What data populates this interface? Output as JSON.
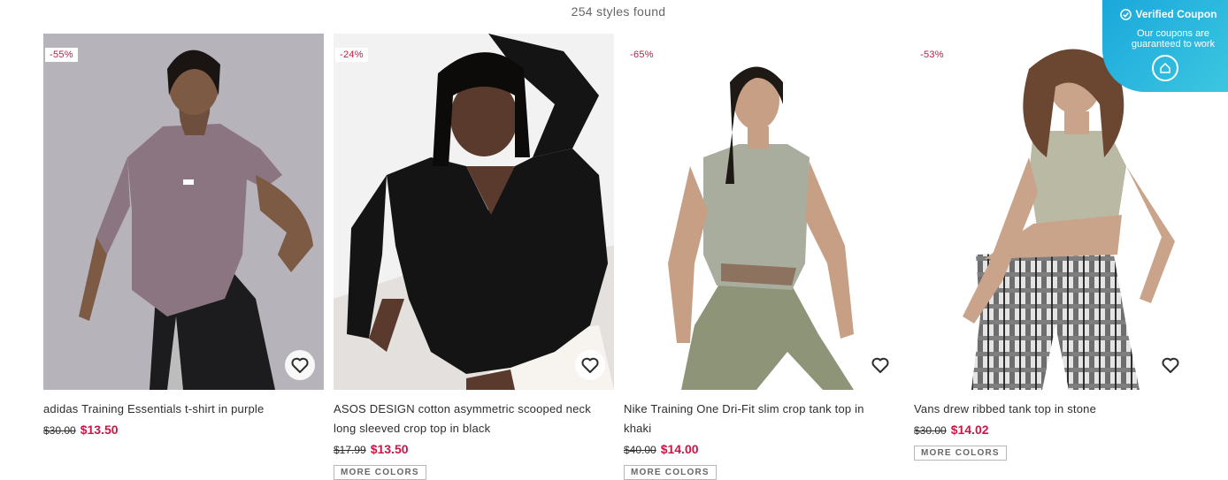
{
  "results": {
    "count_text": "254 styles found"
  },
  "coupon": {
    "title": "Verified Coupon",
    "subtitle": "Our coupons are guaranteed to work",
    "check_icon": "check-circle-icon",
    "logo_icon": "coupon-logo-icon"
  },
  "colors": {
    "sale": "#d01345",
    "coupon_bg": "#1aa8dc"
  },
  "products": [
    {
      "discount": "-55%",
      "title": "adidas Training Essentials t-shirt in purple",
      "old_price": "$30.00",
      "new_price": "$13.50",
      "more_colors": ""
    },
    {
      "discount": "-24%",
      "title": "ASOS DESIGN cotton asymmetric scooped neck long sleeved crop top in black",
      "old_price": "$17.99",
      "new_price": "$13.50",
      "more_colors": "MORE COLORS"
    },
    {
      "discount": "-65%",
      "title": "Nike Training One Dri-Fit slim crop tank top in khaki",
      "old_price": "$40.00",
      "new_price": "$14.00",
      "more_colors": "MORE COLORS"
    },
    {
      "discount": "-53%",
      "title": "Vans drew ribbed tank top in stone",
      "old_price": "$30.00",
      "new_price": "$14.02",
      "more_colors": "MORE COLORS"
    }
  ]
}
